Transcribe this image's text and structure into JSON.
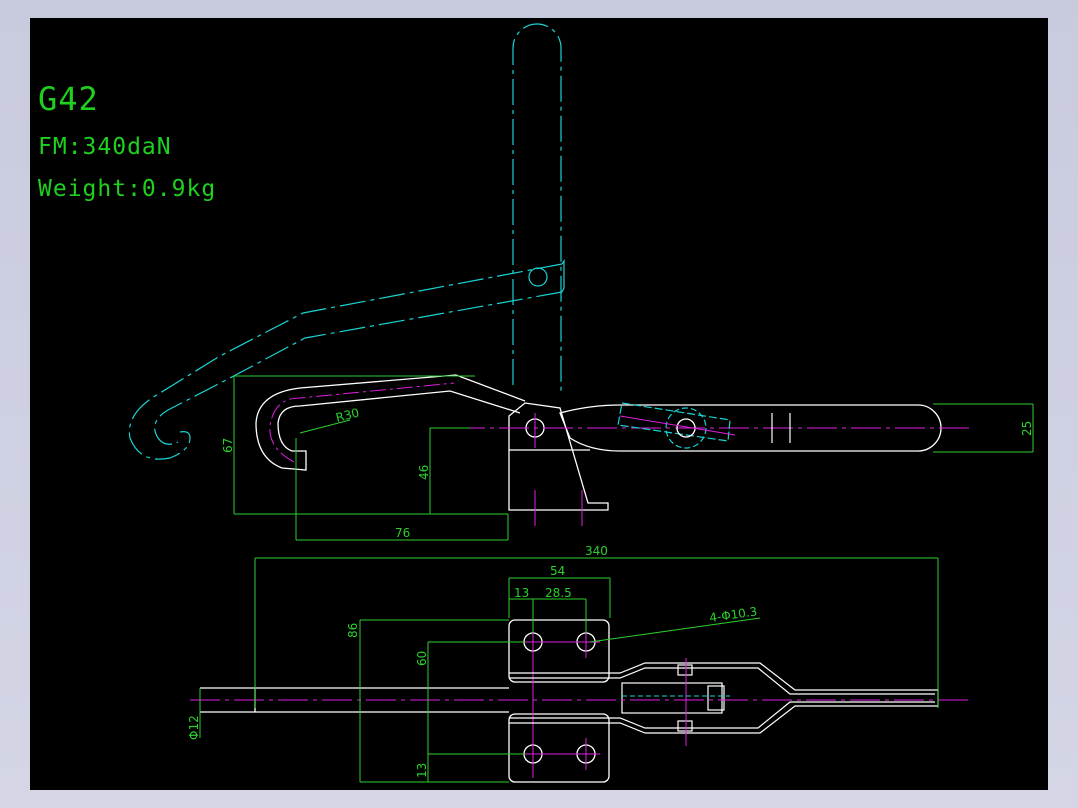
{
  "title": {
    "model": "G42",
    "force": "FM:340daN",
    "weight": "Weight:0.9kg"
  },
  "dimensions": {
    "hook_radius": "R30",
    "overall_height": "67",
    "pivot_height": "46",
    "hook_offset": "76",
    "handle_thickness": "25",
    "overall_length": "340",
    "base_width": "54",
    "hole_edge": "13",
    "hole_pitch_x": "28.5",
    "holes": "4-Φ10.3",
    "base_height": "86",
    "hole_pitch_y": "60",
    "hole_edge_y": "13",
    "rod_diameter": "Φ12"
  },
  "colors": {
    "background": "#000000",
    "outline": "#ffffff",
    "dimension": "#2bd12b",
    "alt_position": "#19d3d3",
    "centerline": "#e020e0",
    "frame": "#cdd0e0"
  }
}
